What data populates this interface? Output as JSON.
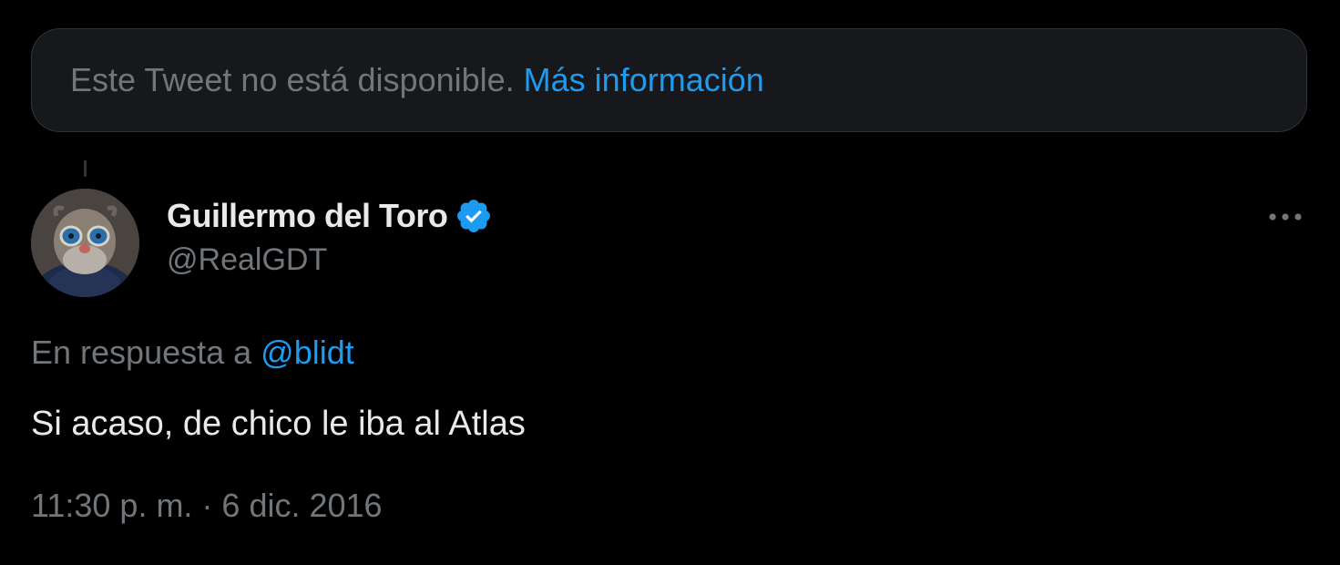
{
  "notice": {
    "text": "Este Tweet no está disponible.",
    "link": "Más información"
  },
  "tweet": {
    "author": {
      "display_name": "Guillermo del Toro",
      "handle": "@RealGDT",
      "verified": true,
      "avatar_icon": "avatar-icon"
    },
    "reply_prefix": "En respuesta a ",
    "reply_to": "@blidt",
    "text": "Si acaso, de chico le iba al Atlas",
    "timestamp": "11:30 p. m. · 6 dic. 2016",
    "more_icon": "more-horizontal-icon"
  },
  "colors": {
    "background": "#000000",
    "card": "#16181c",
    "primary_text": "#e7e9ea",
    "secondary_text": "#71767b",
    "accent": "#1d9bf0"
  }
}
